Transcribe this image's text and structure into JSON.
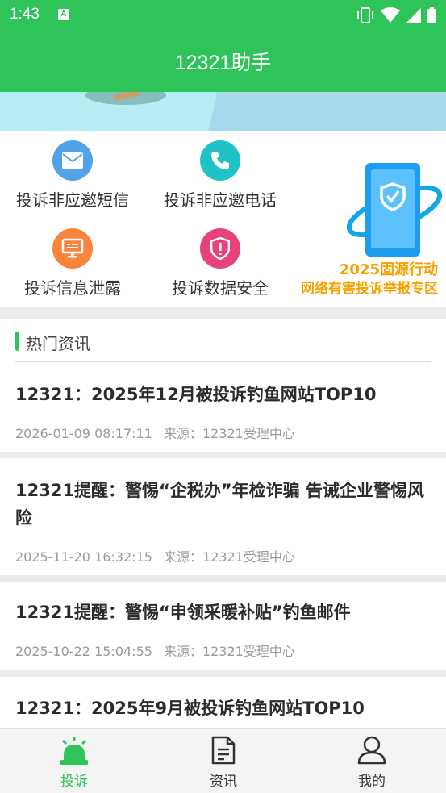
{
  "status_bar": {
    "time": "1:43",
    "notification_icon": "a-icon",
    "system_icons": [
      "vibrate-icon",
      "wifi-icon",
      "signal-icon",
      "battery-icon"
    ]
  },
  "header": {
    "title": "12321助手"
  },
  "menu": {
    "items": [
      {
        "label": "投诉非应邀短信",
        "icon": "envelope-icon",
        "color": "#4fa3e6"
      },
      {
        "label": "投诉非应邀电话",
        "icon": "phone-icon",
        "color": "#1fc3c7"
      },
      {
        "label": "投诉信息泄露",
        "icon": "monitor-icon",
        "color": "#f7843a"
      },
      {
        "label": "投诉数据安全",
        "icon": "shield-alert-icon",
        "color": "#e8427a"
      }
    ],
    "zone": {
      "icon": "phone-shield-icon",
      "line1": "2025固源行动",
      "line2": "网络有害投诉举报专区",
      "color": "#f7a100"
    }
  },
  "news": {
    "section_title": "热门资讯",
    "accent": "#2ec45a",
    "items": [
      {
        "title": "12321：2025年12月被投诉钓鱼网站TOP10",
        "time": "2026-01-09 08:17:11",
        "source": "来源：12321受理中心"
      },
      {
        "title": "12321提醒：警惕“企税办”年检诈骗 告诫企业警惕风险",
        "time": "2025-11-20 16:32:15",
        "source": "来源：12321受理中心"
      },
      {
        "title": "12321提醒：警惕“申领采暖补贴”钓鱼邮件",
        "time": "2025-10-22 15:04:55",
        "source": "来源：12321受理中心"
      },
      {
        "title": "12321：2025年9月被投诉钓鱼网站TOP10",
        "time": "",
        "source": ""
      }
    ]
  },
  "tabbar": {
    "active_color": "#2ec45a",
    "tabs": [
      {
        "label": "投诉",
        "icon": "alarm-light-icon",
        "active": true
      },
      {
        "label": "资讯",
        "icon": "document-icon",
        "active": false
      },
      {
        "label": "我的",
        "icon": "person-icon",
        "active": false
      }
    ]
  }
}
